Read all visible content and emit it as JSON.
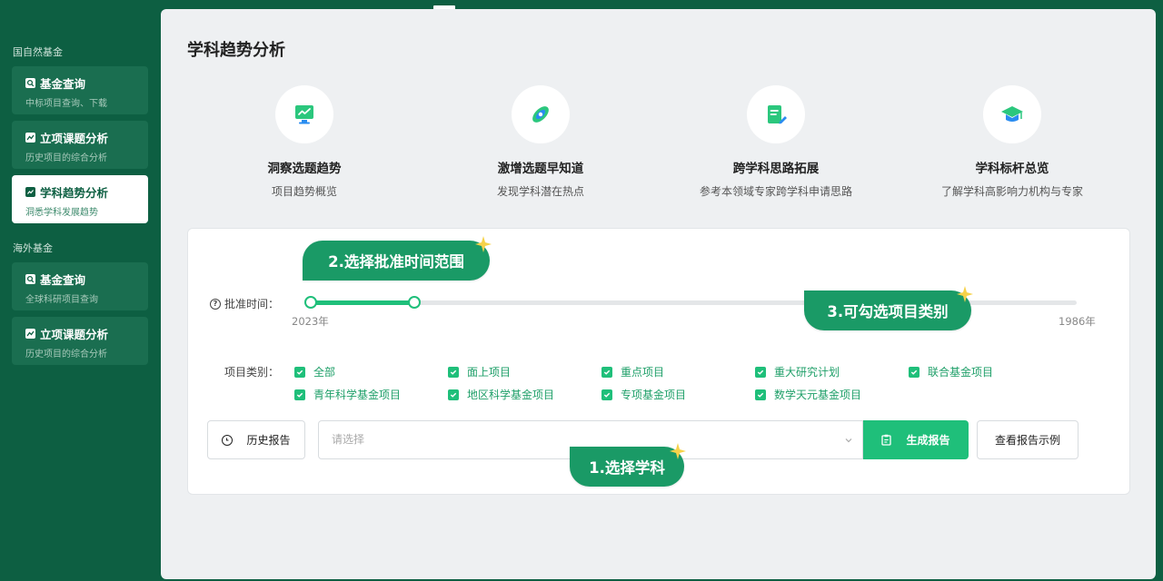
{
  "sidebar": {
    "groups": [
      {
        "title": "国自然基金",
        "items": [
          {
            "label": "基金查询",
            "sub": "中标项目查询、下载",
            "icon": "search-icon"
          },
          {
            "label": "立项课题分析",
            "sub": "历史项目的综合分析",
            "icon": "trend-icon"
          },
          {
            "label": "学科趋势分析",
            "sub": "洞悉学科发展趋势",
            "icon": "chart-icon",
            "active": true
          }
        ]
      },
      {
        "title": "海外基金",
        "items": [
          {
            "label": "基金查询",
            "sub": "全球科研项目查询",
            "icon": "search-icon"
          },
          {
            "label": "立项课题分析",
            "sub": "历史项目的综合分析",
            "icon": "trend-icon"
          }
        ]
      }
    ]
  },
  "main": {
    "title": "学科趋势分析",
    "features": [
      {
        "title": "洞察选题趋势",
        "sub": "项目趋势概览",
        "icon": "monitor-chart-icon"
      },
      {
        "title": "激增选题早知道",
        "sub": "发现学科潜在热点",
        "icon": "rocket-icon"
      },
      {
        "title": "跨学科思路拓展",
        "sub": "参考本领域专家跨学科申请思路",
        "icon": "document-edit-icon"
      },
      {
        "title": "学科标杆总览",
        "sub": "了解学科高影响力机构与专家",
        "icon": "graduation-cap-icon"
      }
    ]
  },
  "panel": {
    "time_label": "批准时间：",
    "year_start": "2023年",
    "year_end": "1986年",
    "range_fraction": [
      0.0,
      0.135
    ],
    "category_label": "项目类别：",
    "categories": [
      {
        "label": "全部",
        "checked": true
      },
      {
        "label": "面上项目",
        "checked": true
      },
      {
        "label": "重点项目",
        "checked": true
      },
      {
        "label": "重大研究计划",
        "checked": true
      },
      {
        "label": "联合基金项目",
        "checked": true
      },
      {
        "label": "青年科学基金项目",
        "checked": true
      },
      {
        "label": "地区科学基金项目",
        "checked": true
      },
      {
        "label": "专项基金项目",
        "checked": true
      },
      {
        "label": "数学天元基金项目",
        "checked": true
      }
    ],
    "history_button": "历史报告",
    "select_placeholder": "请选择",
    "generate_button": "生成报告",
    "example_button": "查看报告示例"
  },
  "callouts": {
    "step1": "1.选择学科",
    "step2": "2.选择批准时间范围",
    "step3": "3.可勾选项目类别"
  },
  "colors": {
    "sidebar_bg": "#0d5f42",
    "accent": "#1fbf7a",
    "callout": "#1a9a66"
  }
}
